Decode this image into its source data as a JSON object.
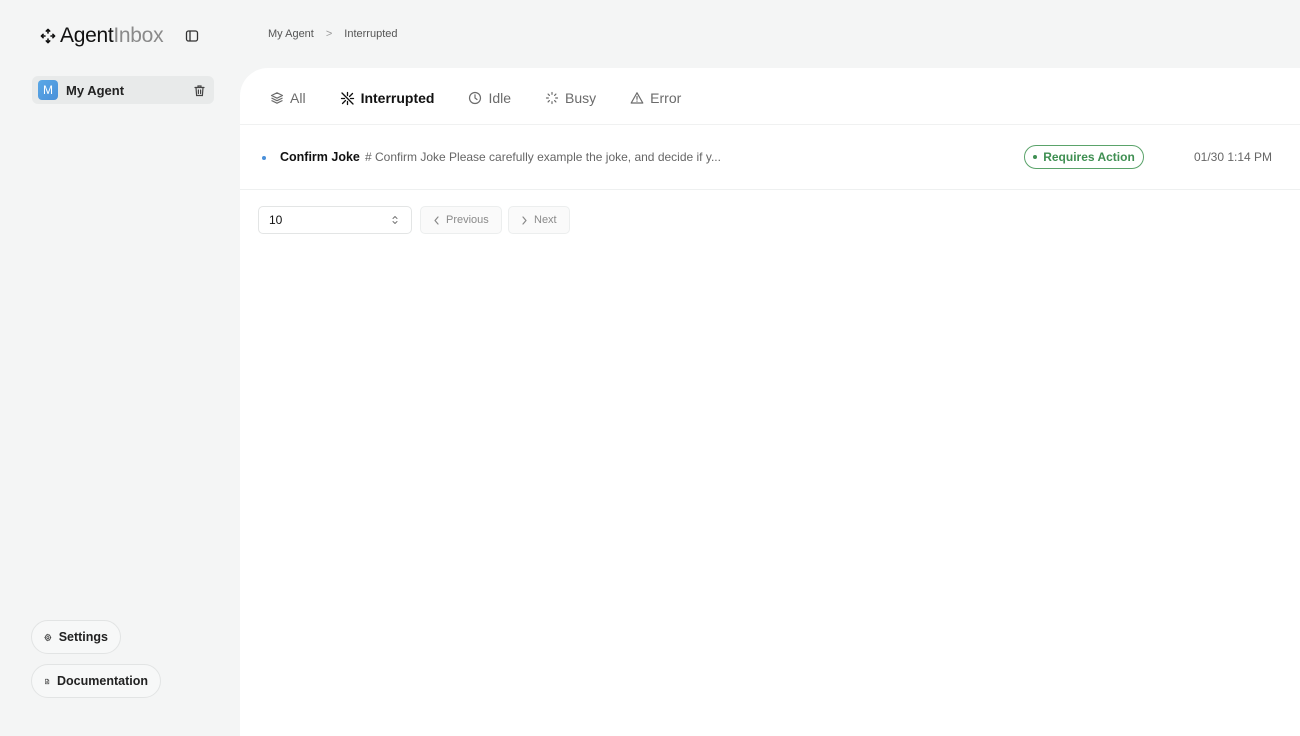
{
  "app": {
    "logo_bold": "Agent",
    "logo_light": "Inbox"
  },
  "sidebar": {
    "agents": [
      {
        "initial": "M",
        "name": "My Agent",
        "selected": true
      }
    ],
    "settings_label": "Settings",
    "documentation_label": "Documentation"
  },
  "breadcrumb": {
    "items": [
      "My Agent",
      "Interrupted"
    ],
    "separator": ">"
  },
  "tabs": [
    {
      "label": "All",
      "icon": "layers-icon",
      "active": false
    },
    {
      "label": "Interrupted",
      "icon": "interrupted-icon",
      "active": true
    },
    {
      "label": "Idle",
      "icon": "clock-icon",
      "active": false
    },
    {
      "label": "Busy",
      "icon": "loader-icon",
      "active": false
    },
    {
      "label": "Error",
      "icon": "warning-triangle-icon",
      "active": false
    }
  ],
  "threads": [
    {
      "title": "Confirm Joke",
      "description": "# Confirm Joke Please carefully example the joke, and decide if y...",
      "status": "Requires Action",
      "timestamp": "01/30 1:14 PM"
    }
  ],
  "pagination": {
    "page_size": "10",
    "previous_label": "Previous",
    "next_label": "Next"
  },
  "colors": {
    "accent_blue": "#4a90d9",
    "status_green": "#3f8f52",
    "sidebar_bg": "#f4f5f5",
    "panel_bg": "#ffffff"
  }
}
